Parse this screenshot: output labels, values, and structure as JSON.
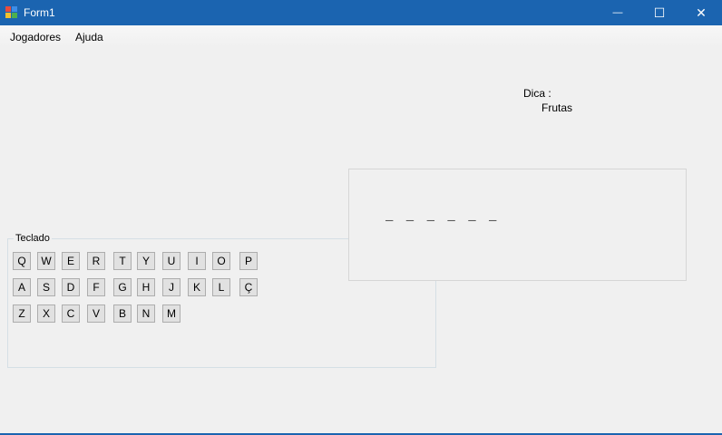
{
  "window": {
    "title": "Form1",
    "minimize_glyph": "—",
    "maximize_glyph": "☐",
    "close_glyph": "✕",
    "accent": "#1b64b0"
  },
  "menu": {
    "items": [
      "Jogadores",
      "Ajuda"
    ]
  },
  "hint": {
    "label": "Dica :",
    "value": "Frutas"
  },
  "word": {
    "masked": "_ _ _ _ _ _"
  },
  "keyboard": {
    "legend": "Teclado",
    "rows": [
      [
        "Q",
        "W",
        "E",
        "R",
        "T",
        "Y",
        "U",
        "I",
        "O",
        "P"
      ],
      [
        "A",
        "S",
        "D",
        "F",
        "G",
        "H",
        "J",
        "K",
        "L",
        "Ç"
      ],
      [
        "Z",
        "X",
        "C",
        "V",
        "B",
        "N",
        "M"
      ]
    ]
  }
}
